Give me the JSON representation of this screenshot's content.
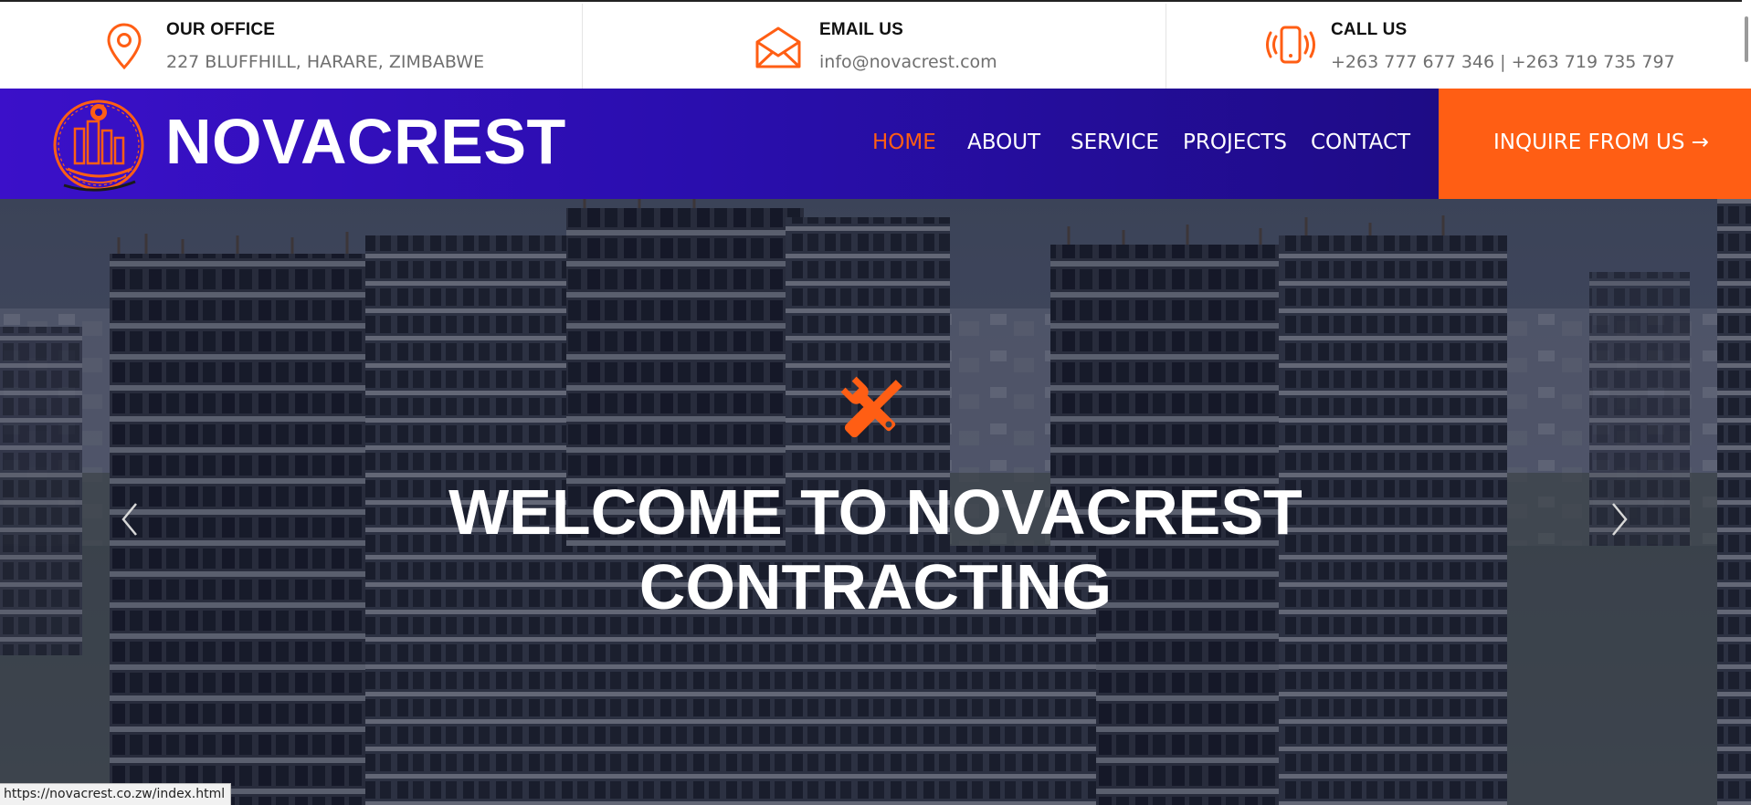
{
  "topbar": {
    "office": {
      "title": "OUR OFFICE",
      "text": "227 BLUFFHILL, HARARE, ZIMBABWE",
      "icon": "map-pin-icon"
    },
    "email": {
      "title": "EMAIL US",
      "text": "info@novacrest.com",
      "icon": "envelope-icon"
    },
    "call": {
      "title": "CALL US",
      "text": "+263 777 677 346 | +263 719 735 797",
      "icon": "phone-ringing-icon"
    }
  },
  "nav": {
    "brand": "NOVACREST",
    "links": [
      {
        "label": "HOME",
        "active": true
      },
      {
        "label": "ABOUT",
        "active": false
      },
      {
        "label": "SERVICE",
        "active": false
      },
      {
        "label": "PROJECTS",
        "active": false
      },
      {
        "label": "CONTACT",
        "active": false
      }
    ],
    "cta": "INQUIRE FROM US →"
  },
  "hero": {
    "icon": "tools-wrench-screwdriver-icon",
    "title_line1": "WELCOME TO NOVACREST",
    "title_line2": "CONTRACTING"
  },
  "status_bar": {
    "url": "https://novacrest.co.zw/index.html"
  },
  "colors": {
    "accent": "#ff5e14",
    "nav_gradient_start": "#3b10c9",
    "nav_gradient_end": "#1a0b70",
    "text_dark": "#111111",
    "text_muted": "#6f6f6f"
  }
}
